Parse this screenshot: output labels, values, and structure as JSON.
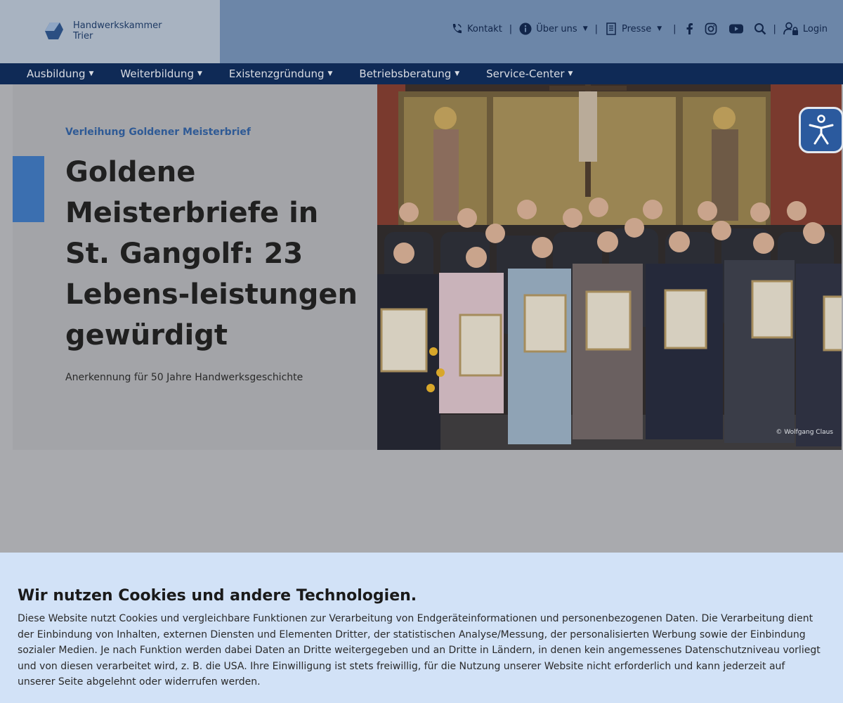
{
  "brand": {
    "name_line1": "Handwerkskammer",
    "name_line2": "Trier"
  },
  "utility_nav": {
    "contact": "Kontakt",
    "about": "Über uns",
    "press": "Presse",
    "login": "Login",
    "separator": "|"
  },
  "main_nav": {
    "items": [
      {
        "label": "Ausbildung"
      },
      {
        "label": "Weiterbildung"
      },
      {
        "label": "Existenzgründung"
      },
      {
        "label": "Betriebsberatung"
      },
      {
        "label": "Service-Center"
      }
    ]
  },
  "hero": {
    "kicker": "Verleihung Goldener Meisterbrief",
    "headline": "Goldene Meisterbriefe in St. Gangolf: 23 Lebens-leistungen gewürdigt",
    "subline": "Anerkennung für 50 Jahre Handwerksgeschichte",
    "photo_credit": "© Wolfgang Claus"
  },
  "cookie_banner": {
    "title": "Wir nutzen Cookies und andere Technologien.",
    "text": "Diese Website nutzt Cookies und vergleichbare Funktionen zur Verarbeitung von Endgeräteinformationen und personenbezogenen Daten. Die Verarbeitung dient der Einbindung von Inhalten, externen Diensten und Elementen Dritter, der statistischen Analyse/Messung, der personalisierten Werbung sowie der Einbindung sozialer Medien. Je nach Funktion werden dabei Daten an Dritte weitergegeben und an Dritte in Ländern, in denen kein angemessenes Datenschutzniveau vorliegt und von diesen verarbeitet wird, z. B. die USA. Ihre Einwilligung ist stets freiwillig, für die Nutzung unserer Website nicht erforderlich und kann jederzeit auf unserer Seite abgelehnt oder widerrufen werden."
  },
  "colors": {
    "topbar": "#6c86a8",
    "nav": "#0f2a56",
    "accent": "#3b6fb0",
    "cookie_bg": "#d2e2f7"
  },
  "icons": [
    "phone-icon",
    "info-icon",
    "document-icon",
    "facebook-icon",
    "instagram-icon",
    "youtube-icon",
    "search-icon",
    "user-lock-icon",
    "accessibility-icon"
  ]
}
